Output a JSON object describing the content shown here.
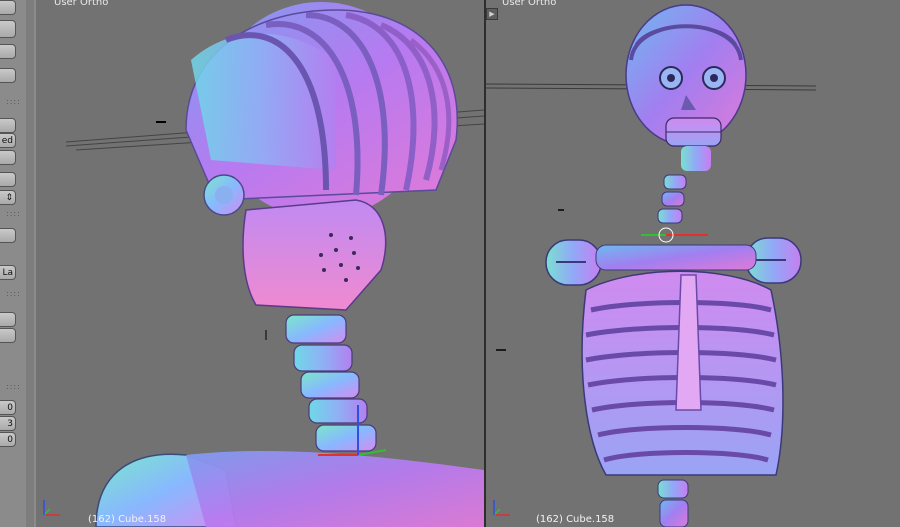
{
  "toolshelf": {
    "buttons": [
      "",
      "",
      "",
      "ed",
      "",
      "",
      "",
      "La",
      "",
      "0",
      "3",
      "0"
    ]
  },
  "viewports": [
    {
      "title": "User Ortho",
      "info": "(162) Cube.158"
    },
    {
      "title": "User Ortho",
      "info": "(162) Cube.158"
    }
  ],
  "axes": {
    "x": "x",
    "y": "y",
    "z": "z"
  },
  "colors": {
    "viewport_bg": "#727272",
    "toolshelf_bg": "#8b8b8b",
    "axis_x": "#e03030",
    "axis_y": "#30c030",
    "axis_z": "#3050e0"
  }
}
